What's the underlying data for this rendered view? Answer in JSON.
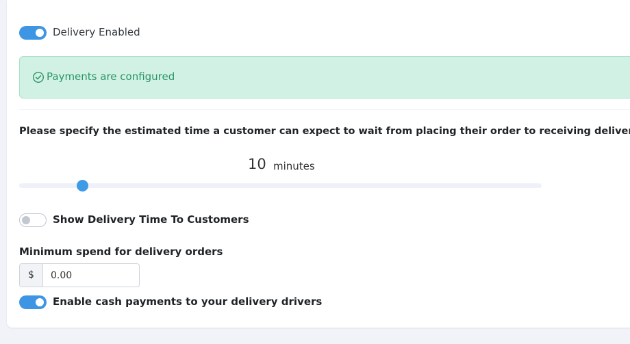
{
  "delivery_toggle": {
    "label": "Delivery Enabled",
    "enabled": true
  },
  "payments_alert": {
    "text": "Payments are configured",
    "icon": "check-circle-icon",
    "color": "#2a9465"
  },
  "wait_time": {
    "question": "Please specify the estimated time a customer can expect to wait from placing their order to receiving delivery",
    "value": "10",
    "unit": "minutes",
    "slider_fraction": 0.12
  },
  "show_time_toggle": {
    "label": "Show Delivery Time To Customers",
    "enabled": false
  },
  "min_spend": {
    "label": "Minimum spend for delivery orders",
    "currency": "$",
    "value": "0.00"
  },
  "cash_toggle": {
    "label": "Enable cash payments to your delivery drivers",
    "enabled": true
  },
  "colors": {
    "accent": "#3e95e3",
    "success_bg": "#d1f1e4",
    "success_text": "#2a9465"
  }
}
